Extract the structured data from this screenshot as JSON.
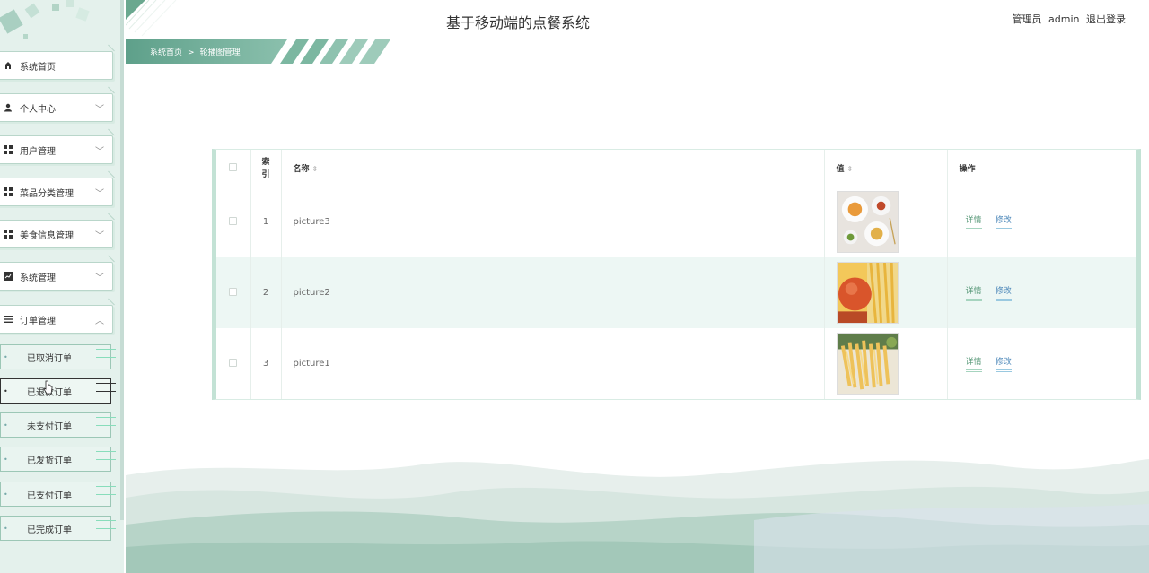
{
  "header": {
    "title": "基于移动端的点餐系统",
    "user_role": "管理员",
    "username": "admin",
    "logout": "退出登录"
  },
  "breadcrumb": {
    "home": "系统首页",
    "separator": ">",
    "current": "轮播图管理"
  },
  "sidebar": {
    "items": [
      {
        "label": "系统首页",
        "icon": "home-icon"
      },
      {
        "label": "个人中心",
        "icon": "person-icon"
      },
      {
        "label": "用户管理",
        "icon": "grid-icon"
      },
      {
        "label": "菜品分类管理",
        "icon": "grid-icon"
      },
      {
        "label": "美食信息管理",
        "icon": "grid-icon"
      },
      {
        "label": "系统管理",
        "icon": "chart-icon"
      },
      {
        "label": "订单管理",
        "icon": "list-icon"
      }
    ],
    "sub_items": [
      {
        "label": "已取消订单"
      },
      {
        "label": "已退款订单"
      },
      {
        "label": "未支付订单"
      },
      {
        "label": "已发货订单"
      },
      {
        "label": "已支付订单"
      },
      {
        "label": "已完成订单"
      }
    ]
  },
  "table": {
    "headers": {
      "index": "索引",
      "name": "名称",
      "value": "值",
      "actions": "操作"
    },
    "rows": [
      {
        "index": "1",
        "name": "picture3",
        "detail": "详情",
        "edit": "修改"
      },
      {
        "index": "2",
        "name": "picture2",
        "detail": "详情",
        "edit": "修改"
      },
      {
        "index": "3",
        "name": "picture1",
        "detail": "详情",
        "edit": "修改"
      }
    ]
  },
  "colors": {
    "brand": "#5fa88c",
    "sidebar_bg": "#e4f1ec",
    "row_stripe": "#edf7f4"
  }
}
